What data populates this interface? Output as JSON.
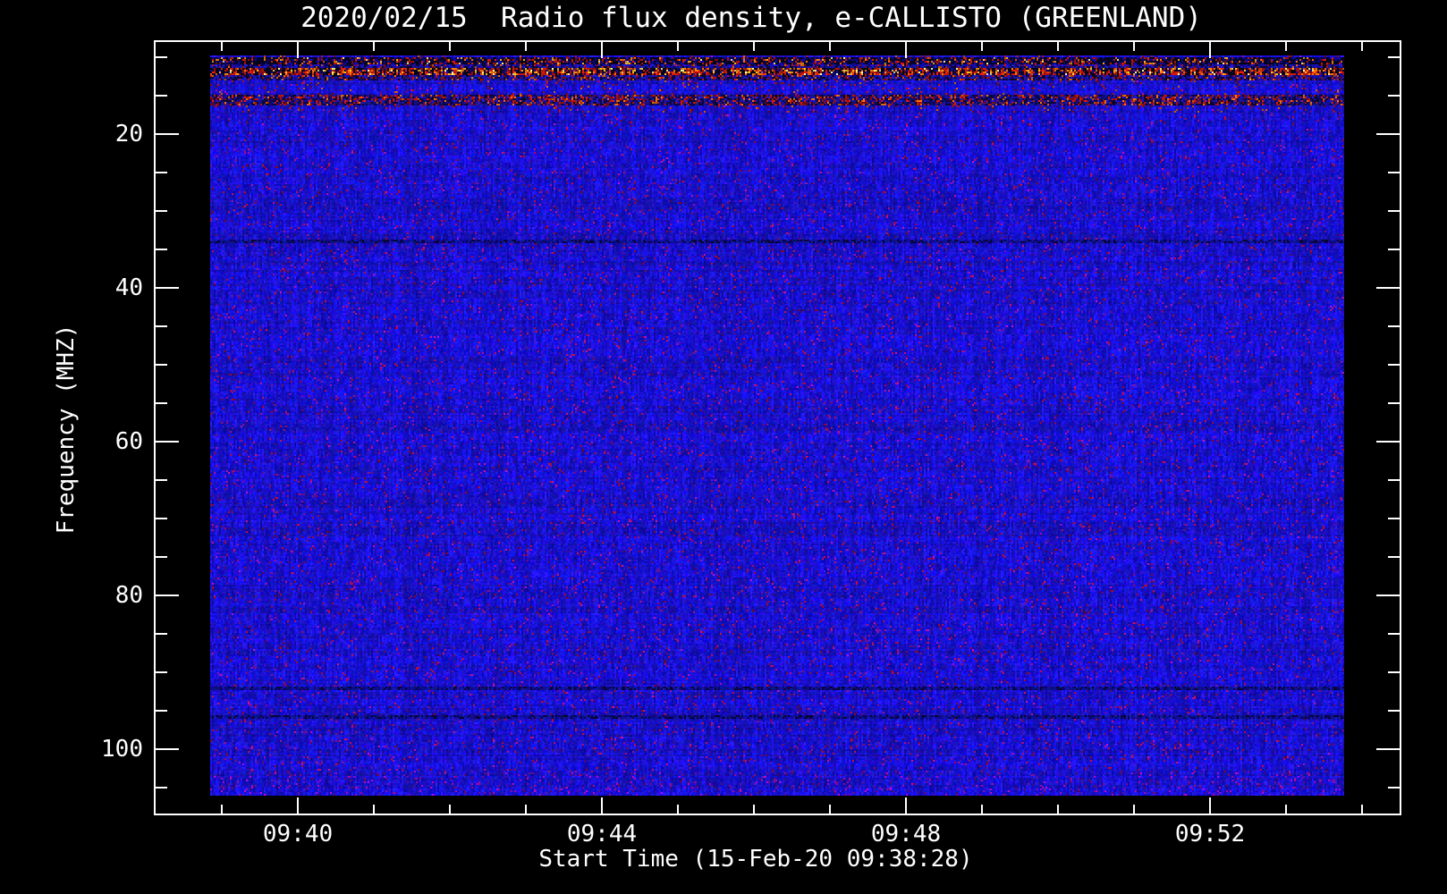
{
  "title": {
    "text": "2020/02/15  Radio flux density, e-CALLISTO (GREENLAND)",
    "color": "#ffffff"
  },
  "axes": {
    "x": {
      "title": "Start Time (15-Feb-20 09:38:28)",
      "major_tick_labels": [
        "09:40",
        "09:44",
        "09:48",
        "09:52"
      ],
      "minor_tick_times": [
        "09:39",
        "09:41",
        "09:42",
        "09:43",
        "09:45",
        "09:46",
        "09:47",
        "09:49",
        "09:50",
        "09:51",
        "09:53",
        "09:54"
      ]
    },
    "y": {
      "title": "Frequency (MHZ)",
      "major_tick_labels": [
        "20",
        "40",
        "60",
        "80",
        "100"
      ],
      "minor_tick_values": [
        10,
        15,
        25,
        30,
        35,
        45,
        50,
        55,
        65,
        70,
        75,
        85,
        90,
        95,
        105
      ],
      "inverted": true
    }
  },
  "chart_data": {
    "type": "heatmap",
    "title": "2020/02/15  Radio flux density, e-CALLISTO (GREENLAND)",
    "xlabel": "Start Time (15-Feb-20 09:38:28)",
    "ylabel": "Frequency (MHZ)",
    "x_start_time": "09:38:28",
    "x_end_time": "09:54:00",
    "x_major_ticks": [
      "09:40",
      "09:44",
      "09:48",
      "09:52"
    ],
    "y_range_mhz": [
      9.9,
      106.0
    ],
    "y_major_ticks_mhz": [
      20,
      40,
      60,
      80,
      100
    ],
    "y_axis_inverted": true,
    "grid": false,
    "legend": "none",
    "description": "Quiet-sun dynamic spectrum: uniform low-flux blue noise across ~10-106 MHz for the full 09:38:28-09:54 interval; narrow horizontal RFI bands below ~17 MHz show black gaps with intense red/orange/yellow interference speckles; no solar burst features.",
    "palette": {
      "background": "#000000",
      "quiet_flux_blue": "#2020e0",
      "low_flux_dark_blue": "#14148c",
      "speckle_purple": "#7a1f8a",
      "hot_red": "#d71910",
      "hot_orange": "#fa6e0a",
      "hot_amber": "#ffb41e",
      "hot_yellow": "#fff08c",
      "axis": "#ffffff"
    },
    "bands": [
      {
        "mhz": [
          9.9,
          10.2
        ],
        "type": "blue_red",
        "speckle_p": 0.18
      },
      {
        "mhz": [
          10.2,
          10.95
        ],
        "type": "dark_speckle",
        "speckle_p": 0.28
      },
      {
        "mhz": [
          10.95,
          11.6
        ],
        "type": "mixed",
        "speckle_p": 0.15
      },
      {
        "mhz": [
          11.6,
          12.35
        ],
        "type": "hot",
        "speckle_p": 0.5
      },
      {
        "mhz": [
          12.35,
          13.05
        ],
        "type": "mixed_red",
        "speckle_p": 0.3
      },
      {
        "mhz": [
          13.05,
          15.1
        ],
        "type": "blue_red",
        "speckle_p": 0.12
      },
      {
        "mhz": [
          15.1,
          16.3
        ],
        "type": "red_band",
        "speckle_p": 0.35
      },
      {
        "mhz": [
          16.3,
          17.3
        ],
        "type": "blue_red",
        "speckle_p": 0.15
      },
      {
        "mhz": [
          33.8,
          34.3
        ],
        "type": "dim",
        "speckle_p": 0.05
      },
      {
        "mhz": [
          91.8,
          92.3
        ],
        "type": "dim",
        "speckle_p": 0.05
      },
      {
        "mhz": [
          95.6,
          96.1
        ],
        "type": "dim",
        "speckle_p": 0.05
      },
      {
        "mhz": [
          103.0,
          106.0
        ],
        "type": "blue_purple",
        "speckle_p": 0.08
      }
    ]
  }
}
